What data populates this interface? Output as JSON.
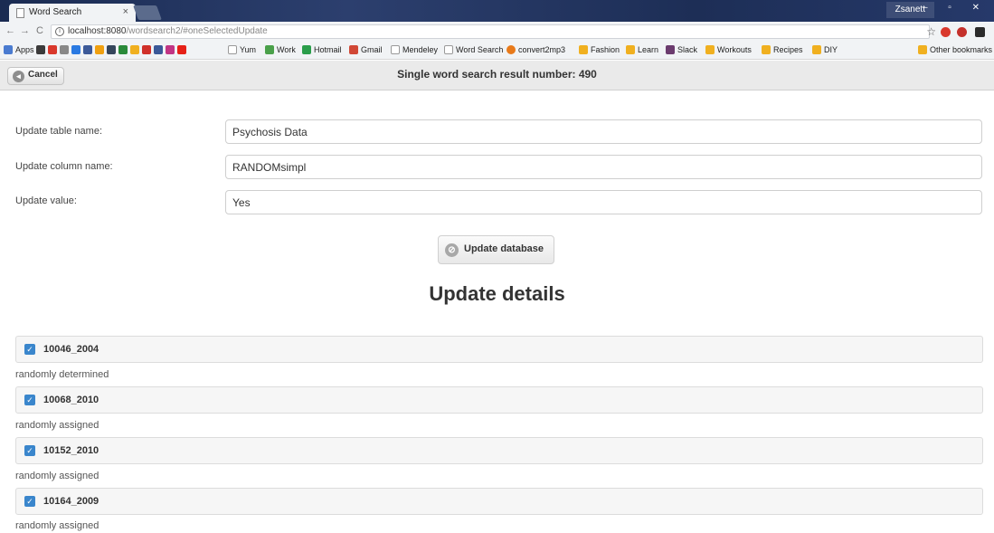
{
  "browser": {
    "tab_title": "Word Search",
    "tab_close": "×",
    "user": "Zsanett",
    "window_controls": "– ▫ ✕",
    "nav_back": "←",
    "nav_forward": "→",
    "nav_reload": "C",
    "url_host": "localhost:8080",
    "url_path": "/wordsearch2/#oneSelectedUpdate",
    "star": "☆",
    "bookmarks": [
      "Apps",
      "Yum",
      "Work",
      "Hotmail",
      "Gmail",
      "Mendeley",
      "Word Search",
      "convert2mp3",
      "Fashion",
      "Learn",
      "Slack",
      "Workouts",
      "Recipes",
      "DIY"
    ],
    "other_bookmarks": "Other bookmarks"
  },
  "header": {
    "cancel_label": "Cancel",
    "title": "Single word search result number: 490"
  },
  "form": {
    "table_label": "Update table name:",
    "table_value": "Psychosis Data",
    "column_label": "Update column name:",
    "column_value": "RANDOMsimpl",
    "value_label": "Update value:",
    "value_value": "Yes",
    "update_button": "Update database"
  },
  "details": {
    "title": "Update details",
    "items": [
      {
        "id": "10046_2004",
        "desc": "randomly determined",
        "checked": true
      },
      {
        "id": "10068_2010",
        "desc": "randomly assigned",
        "checked": true
      },
      {
        "id": "10152_2010",
        "desc": "randomly assigned",
        "checked": true
      },
      {
        "id": "10164_2009",
        "desc": "randomly assigned",
        "checked": true
      }
    ]
  }
}
